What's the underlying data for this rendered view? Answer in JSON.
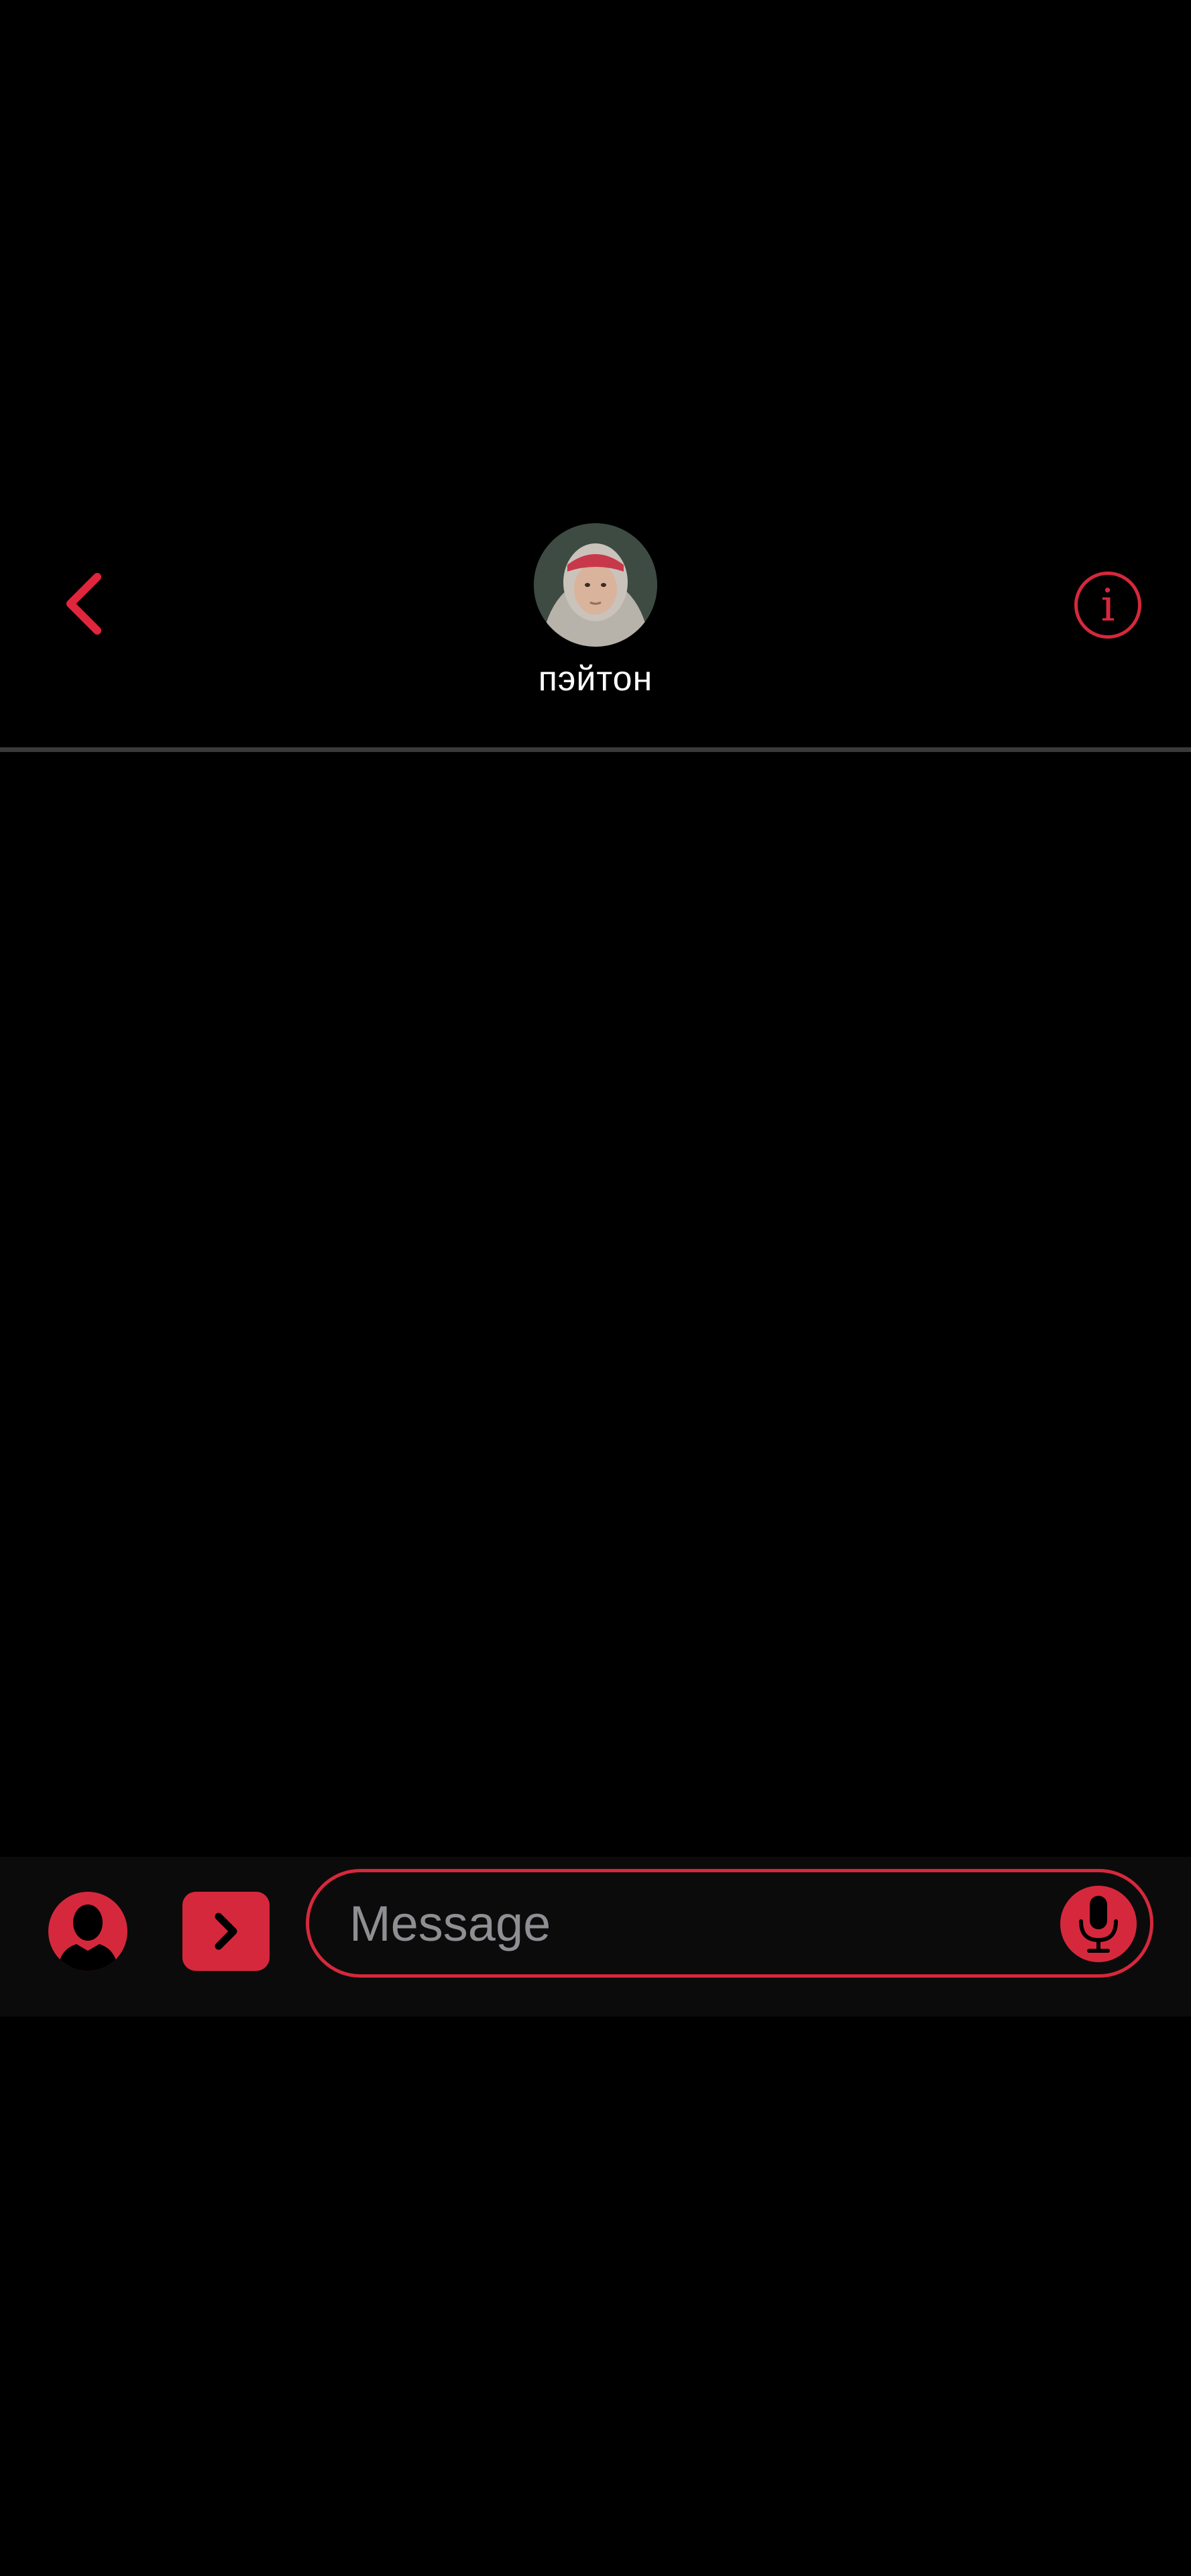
{
  "header": {
    "contact_name": "пэйтон",
    "back_icon": "chevron-left-icon",
    "info_label": "i"
  },
  "composer": {
    "placeholder": "Message",
    "value": "",
    "contacts_icon": "person-icon",
    "apps_icon": "chevron-right-icon",
    "mic_icon": "microphone-icon"
  },
  "theme": {
    "accent": "#d6283c",
    "background": "#000000",
    "composer_background": "#0b0b0b",
    "divider": "#3a3a3a",
    "placeholder": "#8e8e93"
  }
}
